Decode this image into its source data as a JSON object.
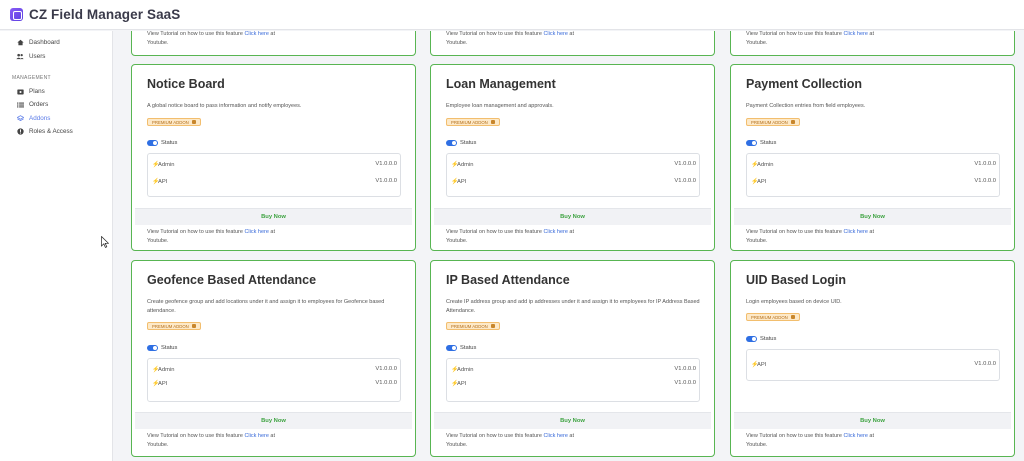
{
  "app": {
    "title": "CZ Field Manager SaaS"
  },
  "sidebar": {
    "items_top": [
      {
        "label": "Dashboard",
        "icon": "home-icon"
      },
      {
        "label": "Users",
        "icon": "users-icon"
      }
    ],
    "section_label": "MANAGEMENT",
    "items_mgmt": [
      {
        "label": "Plans",
        "icon": "plans-icon"
      },
      {
        "label": "Orders",
        "icon": "list-icon"
      },
      {
        "label": "Addons",
        "icon": "layers-icon",
        "active": true
      },
      {
        "label": "Roles & Access",
        "icon": "shield-icon"
      }
    ]
  },
  "common": {
    "badge": "PREMIUM ADDON",
    "status_label": "Status",
    "buy_label": "Buy Now",
    "tutorial_prefix": "View Tutorial on how to use this feature",
    "tutorial_link": "Click here",
    "tutorial_suffix_1": "at",
    "tutorial_suffix_2": "Youtube."
  },
  "cards": [
    {
      "title": "Notice Board",
      "description": "A global notice board to pass information and notify employees.",
      "versions": [
        {
          "label": "Admin",
          "version": "V1.0.0.0"
        },
        {
          "label": "API",
          "version": "V1.0.0.0"
        }
      ]
    },
    {
      "title": "Loan Management",
      "description": "Employee loan management and approvals.",
      "versions": [
        {
          "label": "Admin",
          "version": "V1.0.0.0"
        },
        {
          "label": "API",
          "version": "V1.0.0.0"
        }
      ]
    },
    {
      "title": "Payment Collection",
      "description": "Payment Collection entries from field employees.",
      "versions": [
        {
          "label": "Admin",
          "version": "V1.0.0.0"
        },
        {
          "label": "API",
          "version": "V1.0.0.0"
        }
      ]
    },
    {
      "title": "Geofence Based Attendance",
      "description": "Create geofence group and add locations under it and assign it to employees for Geofence based attendance.",
      "versions": [
        {
          "label": "Admin",
          "version": "V1.0.0.0"
        },
        {
          "label": "API",
          "version": "V1.0.0.0"
        }
      ]
    },
    {
      "title": "IP Based Attendance",
      "description": "Create IP address group and add ip addresses under it and assign it to employees for IP Address Based Attendance.",
      "versions": [
        {
          "label": "Admin",
          "version": "V1.0.0.0"
        },
        {
          "label": "API",
          "version": "V1.0.0.0"
        }
      ]
    },
    {
      "title": "UID Based Login",
      "description": "Login employees based on device UID.",
      "versions": [
        {
          "label": "API",
          "version": "V1.0.0.0"
        }
      ]
    }
  ],
  "colors": {
    "border": "#58b552",
    "accent": "#3769d9",
    "buy": "#3da240",
    "badge_bg": "#fde9c8"
  }
}
